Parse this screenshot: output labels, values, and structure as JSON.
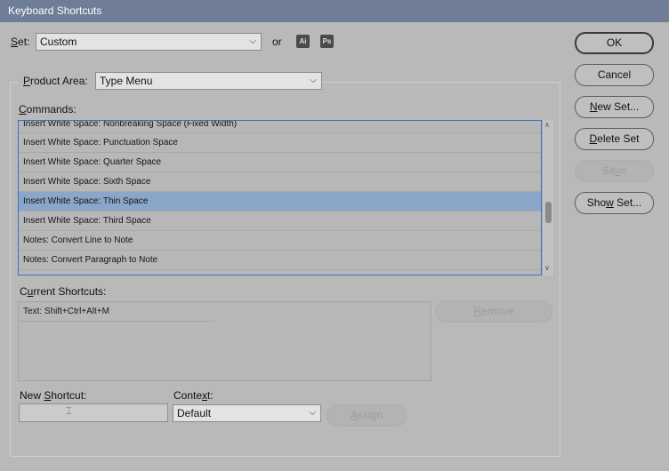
{
  "window": {
    "title": "Keyboard Shortcuts"
  },
  "set": {
    "label_ul": "S",
    "label_rest": "et:",
    "value": "Custom",
    "or_text": "or",
    "icon_ai": "Ai",
    "icon_ps": "Ps"
  },
  "product_area": {
    "label_ul": "P",
    "label_rest": "roduct Area:",
    "value": "Type Menu"
  },
  "commands": {
    "label_ul": "C",
    "label_rest": "ommands:",
    "items": [
      "Insert White Space: Nonbreaking Space (Fixed Width)",
      "Insert White Space: Punctuation Space",
      "Insert White Space: Quarter Space",
      "Insert White Space: Sixth Space",
      "Insert White Space: Thin Space",
      "Insert White Space: Third Space",
      "Notes: Convert Line to Note",
      "Notes: Convert Paragraph to Note"
    ],
    "selected_index": 4
  },
  "current_shortcuts": {
    "label_pre": "C",
    "label_ul": "u",
    "label_rest": "rrent Shortcuts:",
    "items": [
      "Text: Shift+Ctrl+Alt+M"
    ],
    "remove_ul": "R",
    "remove_rest": "emove"
  },
  "new_shortcut": {
    "label_pre": "New ",
    "label_ul": "S",
    "label_rest": "hortcut:",
    "value": ""
  },
  "context": {
    "label_pre": "Conte",
    "label_ul": "x",
    "label_rest": "t:",
    "value": "Default"
  },
  "assign": {
    "label_ul": "A",
    "label_rest": "ssign"
  },
  "buttons": {
    "ok": "OK",
    "cancel": "Cancel",
    "new_set_ul": "N",
    "new_set_rest": "ew Set...",
    "delete_set_ul": "D",
    "delete_set_rest": "elete Set",
    "save_pre": "Sa",
    "save_ul": "v",
    "save_rest": "e",
    "show_set_pre": "Sho",
    "show_set_ul": "w",
    "show_set_rest": " Set..."
  },
  "colors": {
    "titlebar": "#6f7d96",
    "selection": "#8aa6c8",
    "focus_border": "#3d6ec7",
    "background": "#b9b9b9"
  }
}
